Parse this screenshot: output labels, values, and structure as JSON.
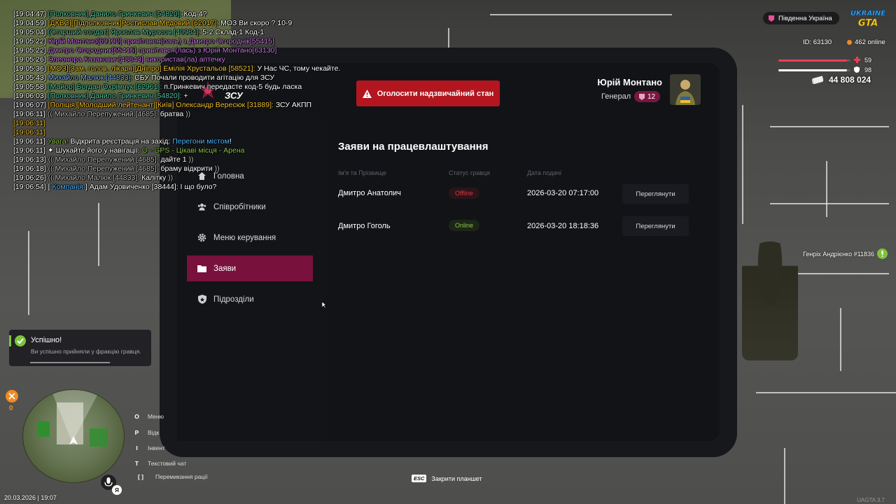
{
  "hud": {
    "location": "Південна Україна",
    "player_id": "ID: 63130",
    "online": "462 online",
    "health": "59",
    "armor": "98",
    "health_fraction": 0.95,
    "armor_fraction": 0.95,
    "money": "44 808 024",
    "npc_tag": "Генріх Андрієнко #11836",
    "datetime": "20.03.2026 | 19:07",
    "version": "UAGTA 3.7",
    "logo_line1": "UKRAINE",
    "logo_line2": "GTA",
    "colors": {
      "health": "#e94057",
      "armor": "#ffffff",
      "accent": "#78113c",
      "danger": "#b3161f"
    }
  },
  "chat": [
    {
      "t": "[19:04:47] ",
      "parts": [
        [
          "[Полковник] Данило Гринкевич [54820]: ",
          "#55c9a0"
        ],
        [
          "Код-4?",
          "#ffffff"
        ]
      ]
    },
    {
      "t": "[19:04:59] ",
      "parts": [
        [
          "[ДКВС][Підполковник]Ростислав Медовий [62017]: ",
          "#f0c030"
        ],
        [
          "МОЗ Ви скоро ? 10-9",
          "#ffffff"
        ]
      ]
    },
    {
      "t": "[19:05:04] ",
      "parts": [
        [
          "[Старший солдат] Ярослав Мурасов [40984]: ",
          "#55c9a0"
        ],
        [
          "5-2 Склад-1 Код-1",
          "#ffffff"
        ]
      ]
    },
    {
      "t": "[19:05:22] ",
      "parts": [
        [
          "Юрій Монтано[63130] привітався(лась) з Дмитро Огороднік[55415]",
          "#c77ae0"
        ]
      ]
    },
    {
      "t": "[19:05:22] ",
      "parts": [
        [
          "Дмитро Огородник[55415] привітався(лась) з Юрій Монтано[63130]",
          "#c77ae0"
        ]
      ]
    },
    {
      "t": "[19:05:26] ",
      "parts": [
        [
          "Элеонора Казакович[48843] використав(ла) аптечку",
          "#c77ae0"
        ]
      ]
    },
    {
      "t": "[19:05:36] ",
      "parts": [
        [
          "[МОЗ][Зам. голов. лікаря][Дніпро] Емілія Хрустальов [58521]: ",
          "#f0c030"
        ],
        [
          "У Нас ЧС, тому чекайте.",
          "#ffffff"
        ]
      ]
    },
    {
      "t": "[19:05:43] ",
      "parts": [
        [
          "Михайло Малюк [44833]: ",
          "#7fb4ff"
        ],
        [
          "СБУ Почали проводити агітацію для ЗСУ",
          "#ffffff"
        ]
      ]
    },
    {
      "t": "[19:05:58] ",
      "parts": [
        [
          "[Майор] Богдан Охрімчук [62961]: ",
          "#55c9a0"
        ],
        [
          "п.Гринкевич передасте код-5 будь ласка",
          "#ffffff"
        ]
      ]
    },
    {
      "t": "[19:06:03] ",
      "parts": [
        [
          "[Полковник] Данило Гринкевич [54820]: ",
          "#55c9a0"
        ],
        [
          "+",
          "#ffffff"
        ]
      ]
    },
    {
      "t": "[19:06:07] ",
      "parts": [
        [
          "[Поліція][Молодший лейтенант][Київ] Олександр Вересюк [31889]: ",
          "#f0c030"
        ],
        [
          "ЗСУ АКПП",
          "#ffffff"
        ]
      ]
    },
    {
      "t": "[19:06:11] ",
      "parts": [
        [
          "(( Михайло Перепужений [4685]: ",
          "#bbbbbb"
        ],
        [
          "братва",
          "#ffffff"
        ],
        [
          " ))",
          "#bbbbbb"
        ]
      ]
    },
    {
      "t": "[19:06:11]",
      "parts": [],
      "tc": "#f0c030"
    },
    {
      "t": "[19:06:11]",
      "parts": [],
      "tc": "#f0c030"
    },
    {
      "t": "[19:06:11] ",
      "parts": [
        [
          "Увага! ",
          "#8bc34a"
        ],
        [
          "Відкрита реєстрація на захід: ",
          "#ffffff"
        ],
        [
          "Перегони містом",
          "#4fb6ff"
        ],
        [
          "!",
          "#ffffff"
        ]
      ]
    },
    {
      "t": "[19:06:11] ",
      "parts": [
        [
          "✦  Шукайте його у навігації: ",
          "#ffffff"
        ],
        [
          "O - GPS - Цікаві місця - Арена",
          "#8bc34a"
        ]
      ]
    },
    {
      "t": "[19:06:13] ",
      "parts": [
        [
          "(( Михайло Перепужений [4685]: ",
          "#bbbbbb"
        ],
        [
          "дайте 1",
          "#ffffff"
        ],
        [
          " ))",
          "#bbbbbb"
        ]
      ]
    },
    {
      "t": "[19:06:18] ",
      "parts": [
        [
          "(( Михайло Перепужений [4685]: ",
          "#bbbbbb"
        ],
        [
          "браму відкрити",
          "#ffffff"
        ],
        [
          " ))",
          "#bbbbbb"
        ]
      ]
    },
    {
      "t": "[19:06:26] ",
      "parts": [
        [
          "(( Михайло Малюк [44833]: ",
          "#bbbbbb"
        ],
        [
          "Калітку",
          "#ffffff"
        ],
        [
          " ))",
          "#bbbbbb"
        ]
      ]
    },
    {
      "t": "[19:06:54] ",
      "parts": [
        [
          "[ ",
          "#ffffff"
        ],
        [
          "Компанія",
          "#4fb6ff"
        ],
        [
          " ] Адам Удовиченко [38444]: І що було?",
          "#ffffff"
        ]
      ]
    }
  ],
  "tablet": {
    "brand": "ЗСУ",
    "emergency_button": "Оголосити надзвичайний стан",
    "user": {
      "name": "Юрій Монтано",
      "rank": "Генерал",
      "level": "12"
    },
    "nav": [
      {
        "label": "Головна",
        "icon": "home-icon"
      },
      {
        "label": "Співробітники",
        "icon": "users-icon"
      },
      {
        "label": "Меню керування",
        "icon": "gear-icon"
      },
      {
        "label": "Заяви",
        "icon": "folder-icon",
        "active": true
      },
      {
        "label": "Підрозділи",
        "icon": "shield-icon"
      }
    ],
    "title": "Заяви на працевлаштування",
    "columns": [
      "Ім'я та Прізвище",
      "Статус гравця",
      "Дата подачі"
    ],
    "rows": [
      {
        "name": "Дмитро Анатолич",
        "status": "Offline",
        "date": "2026-03-20 07:17:00",
        "action": "Переглянути"
      },
      {
        "name": "Дмитро Гоголь",
        "status": "Online",
        "date": "2026-03-20 18:18:36",
        "action": "Переглянути"
      }
    ]
  },
  "toast": {
    "title": "Успішно!",
    "message": "Ви успішно прийняли у фракцію гравця."
  },
  "hints": [
    {
      "key": "O",
      "label": "Меню"
    },
    {
      "key": "P",
      "label": "Відк"
    },
    {
      "key": "I",
      "label": "Інвент"
    },
    {
      "key": "T",
      "label": "Текстовий чат"
    },
    {
      "key": "[  ]",
      "label": "Перемикання рації"
    }
  ],
  "minimap_badge": "Я",
  "hunger": "0",
  "footer": {
    "esc_key": "ESC",
    "esc_label": "Закрити планшет"
  }
}
